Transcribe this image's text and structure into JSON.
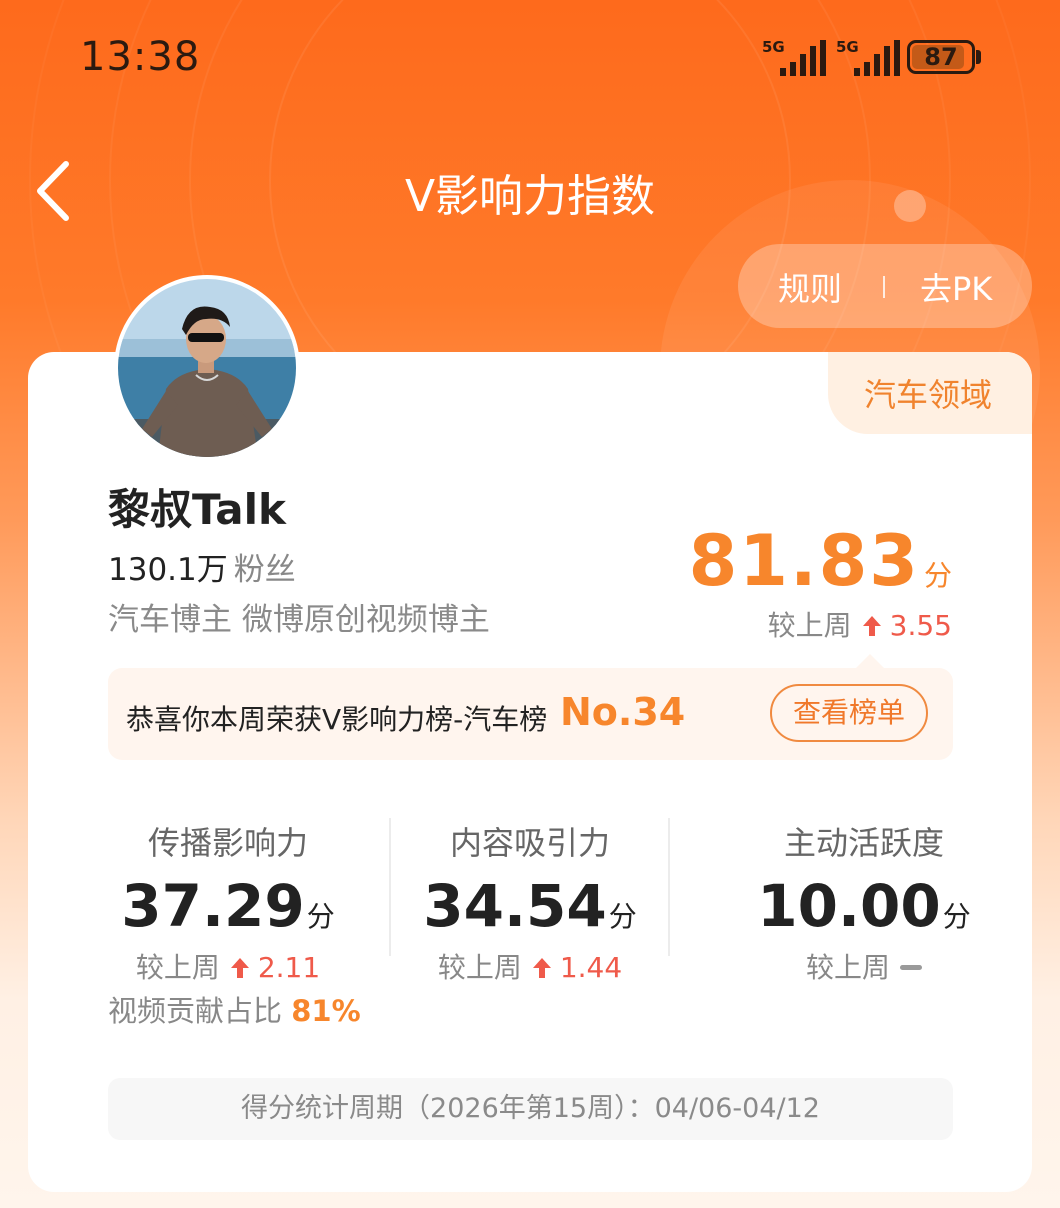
{
  "status_bar": {
    "time": "13:38",
    "signal_1": "5G",
    "signal_2": "5G",
    "battery": "87"
  },
  "header": {
    "title": "V影响力指数",
    "rules_label": "规则",
    "pk_label": "去PK"
  },
  "profile": {
    "domain": "汽车领域",
    "name": "黎叔Talk",
    "fans_count": "130.1万",
    "fans_label": "粉丝",
    "tags": "汽车博主 微博原创视频博主"
  },
  "score": {
    "value": "81.83",
    "unit": "分",
    "compare_label": "较上周",
    "delta": "3.55",
    "trend": "up"
  },
  "banner": {
    "text": "恭喜你本周荣获V影响力榜-汽车榜",
    "rank": "No.34",
    "button": "查看榜单"
  },
  "metrics": [
    {
      "label": "传播影响力",
      "value": "37.29",
      "unit": "分",
      "compare_label": "较上周",
      "delta": "2.11",
      "trend": "up"
    },
    {
      "label": "内容吸引力",
      "value": "34.54",
      "unit": "分",
      "compare_label": "较上周",
      "delta": "1.44",
      "trend": "up"
    },
    {
      "label": "主动活跃度",
      "value": "10.00",
      "unit": "分",
      "compare_label": "较上周",
      "delta": "",
      "trend": "flat"
    }
  ],
  "contribution": {
    "label": "视频贡献占比",
    "value": "81%"
  },
  "period": "得分统计周期（2026年第15周）：04/06-04/12",
  "colors": {
    "accent": "#f7862c",
    "header_orange": "#fe6a1c",
    "up_red": "#ef5a4a",
    "text_gray": "#888888"
  },
  "icons": [
    "back-arrow-icon",
    "signal-icon",
    "battery-icon",
    "up-arrow-icon",
    "flat-dash-icon"
  ]
}
